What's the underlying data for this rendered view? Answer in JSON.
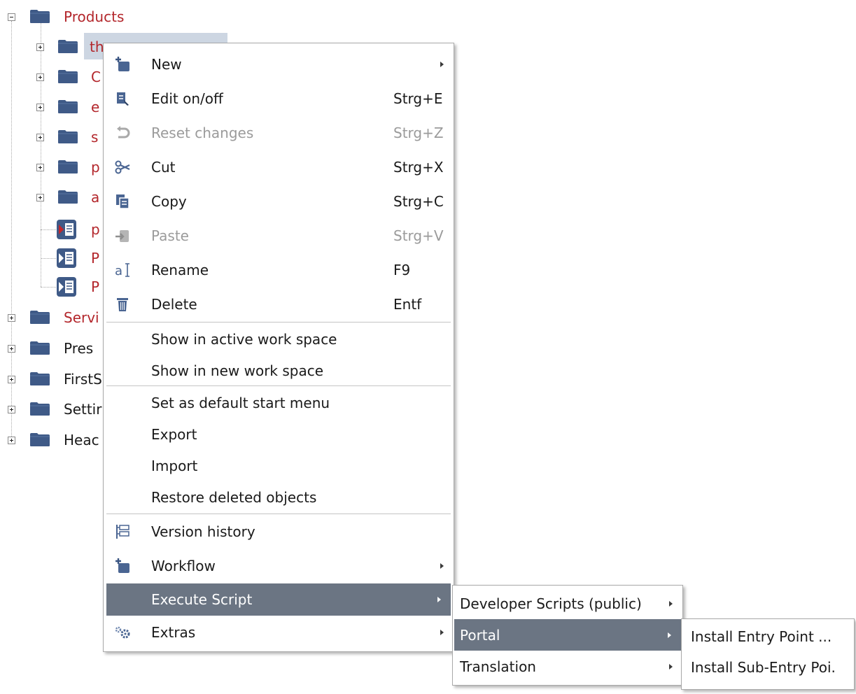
{
  "tree": {
    "root": {
      "label": "Products"
    },
    "children": [
      {
        "label": "th",
        "type": "folder",
        "selected": true
      },
      {
        "label": "C",
        "type": "folder"
      },
      {
        "label": "e",
        "type": "folder"
      },
      {
        "label": "s",
        "type": "folder"
      },
      {
        "label": "p",
        "type": "folder"
      },
      {
        "label": "a",
        "type": "folder"
      },
      {
        "label": "p",
        "type": "page"
      },
      {
        "label": "P",
        "type": "page"
      },
      {
        "label": "P",
        "type": "page"
      }
    ],
    "top_level": [
      {
        "label": "Servi",
        "color": "red"
      },
      {
        "label": "Pres",
        "color": "dark"
      },
      {
        "label": "FirstS",
        "color": "dark"
      },
      {
        "label": "Settir",
        "color": "dark"
      },
      {
        "label": "Heac",
        "color": "dark"
      }
    ]
  },
  "context_menu": {
    "items": [
      {
        "label": "New",
        "shortcut": "",
        "icon": "new-item-icon",
        "submenu": true
      },
      {
        "label": "Edit on/off",
        "shortcut": "Strg+E",
        "icon": "edit-icon"
      },
      {
        "label": "Reset changes",
        "shortcut": "Strg+Z",
        "icon": "undo-icon",
        "disabled": true
      },
      {
        "label": "Cut",
        "shortcut": "Strg+X",
        "icon": "scissors-icon"
      },
      {
        "label": "Copy",
        "shortcut": "Strg+C",
        "icon": "copy-icon"
      },
      {
        "label": "Paste",
        "shortcut": "Strg+V",
        "icon": "paste-icon",
        "disabled": true
      },
      {
        "label": "Rename",
        "shortcut": "F9",
        "icon": "rename-icon"
      },
      {
        "label": "Delete",
        "shortcut": "Entf",
        "icon": "trash-icon"
      },
      {
        "label": "Show in active work space"
      },
      {
        "label": "Show in new work space"
      },
      {
        "label": "Set as default start menu"
      },
      {
        "label": "Export"
      },
      {
        "label": "Import"
      },
      {
        "label": "Restore deleted objects"
      },
      {
        "label": "Version history",
        "icon": "version-history-icon"
      },
      {
        "label": "Workflow",
        "icon": "workflow-icon",
        "submenu": true
      },
      {
        "label": "Execute Script",
        "submenu": true,
        "active": true
      },
      {
        "label": "Extras",
        "icon": "gears-icon",
        "submenu": true
      }
    ]
  },
  "script_menu": {
    "items": [
      {
        "label": "Developer Scripts (public)",
        "submenu": true
      },
      {
        "label": "Portal",
        "submenu": true,
        "active": true
      },
      {
        "label": "Translation",
        "submenu": true
      }
    ]
  },
  "portal_menu": {
    "items": [
      {
        "label": "Install Entry Point ..."
      },
      {
        "label": "Install Sub-Entry Poi."
      }
    ]
  },
  "colors": {
    "folder": "#3f5a87",
    "tree_link": "#b3262b",
    "highlight": "#6b7583",
    "selection": "#cdd6e2"
  }
}
